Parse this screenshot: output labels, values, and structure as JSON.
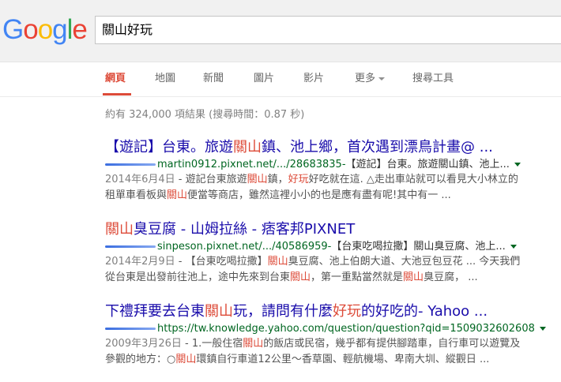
{
  "logo": {
    "letters": [
      "G",
      "o",
      "o",
      "g",
      "l",
      "e"
    ],
    "colors": [
      "#4285f4",
      "#ea4335",
      "#fbbc05",
      "#4285f4",
      "#34a853",
      "#ea4335"
    ]
  },
  "search": {
    "query": "關山好玩"
  },
  "tabs": [
    {
      "label": "網頁",
      "active": true
    },
    {
      "label": "地圖"
    },
    {
      "label": "新聞"
    },
    {
      "label": "圖片"
    },
    {
      "label": "影片"
    },
    {
      "label": "更多"
    },
    {
      "label": "搜尋工具"
    }
  ],
  "stats": "約有 324,000 項結果 (搜尋時間：0.87 秒)",
  "results": [
    {
      "title": [
        {
          "t": "【遊記】台東。旅遊"
        },
        {
          "t": "關山",
          "hl": true
        },
        {
          "t": "鎮、池上鄉，首次遇到漂鳥計畫@ ..."
        }
      ],
      "url": "martin0912.pixnet.net/.../28683835-",
      "url_extra": "【遊記】台東。旅遊關山鎮、池上...",
      "snippet1": [
        {
          "t": "2014年6月4日",
          "date": true
        },
        {
          "t": " - 遊記台東旅遊"
        },
        {
          "t": "關山",
          "hl": true
        },
        {
          "t": "鎮，"
        },
        {
          "t": "好玩",
          "hl": true
        },
        {
          "t": "好吃就在這. △走出車站就可以看見大小林立的"
        }
      ],
      "snippet2": [
        {
          "t": "租單車看板與"
        },
        {
          "t": "關山",
          "hl": true
        },
        {
          "t": "便當等商店，雖然這裡小小的也是應有盡有呢!其中有一 ..."
        }
      ]
    },
    {
      "title": [
        {
          "t": "關山",
          "hl": true
        },
        {
          "t": "臭豆腐 - 山姆拉絲 - 痞客邦PIXNET"
        }
      ],
      "url": "sinpeson.pixnet.net/.../40586959-",
      "url_extra": "【台東吃喝拉撒】關山臭豆腐、池上...",
      "snippet1": [
        {
          "t": "2014年2月9日",
          "date": true
        },
        {
          "t": " - 【台東吃喝拉撒】"
        },
        {
          "t": "關山",
          "hl": true
        },
        {
          "t": "臭豆腐、池上伯朗大道、大池豆包豆花 ... 今天我們"
        }
      ],
      "snippet2": [
        {
          "t": "從台東是出發前往池上，途中先來到台東"
        },
        {
          "t": "關山",
          "hl": true
        },
        {
          "t": "，第一重點當然就是"
        },
        {
          "t": "關山",
          "hl": true
        },
        {
          "t": "臭豆腐， ..."
        }
      ]
    },
    {
      "title": [
        {
          "t": "下禮拜要去台東"
        },
        {
          "t": "關山",
          "hl": true
        },
        {
          "t": "玩，請問有什麼"
        },
        {
          "t": "好玩",
          "hl": true
        },
        {
          "t": "的好吃的- Yahoo ..."
        }
      ],
      "url": "https://tw.knowledge.yahoo.com/question/question?qid=1509032602608",
      "url_extra": "",
      "snippet1": [
        {
          "t": "2009年3月26日",
          "date": true
        },
        {
          "t": " - 1.一般住宿"
        },
        {
          "t": "關山",
          "hl": true
        },
        {
          "t": "的飯店或民宿，幾乎都有提供腳踏車，自行車可以遊覽及"
        }
      ],
      "snippet2": [
        {
          "t": "參觀的地方：○"
        },
        {
          "t": "關山",
          "hl": true
        },
        {
          "t": "環鎮自行車道12公里～香草園、輕航機場、卑南大圳、縱觀日 ..."
        }
      ]
    }
  ]
}
